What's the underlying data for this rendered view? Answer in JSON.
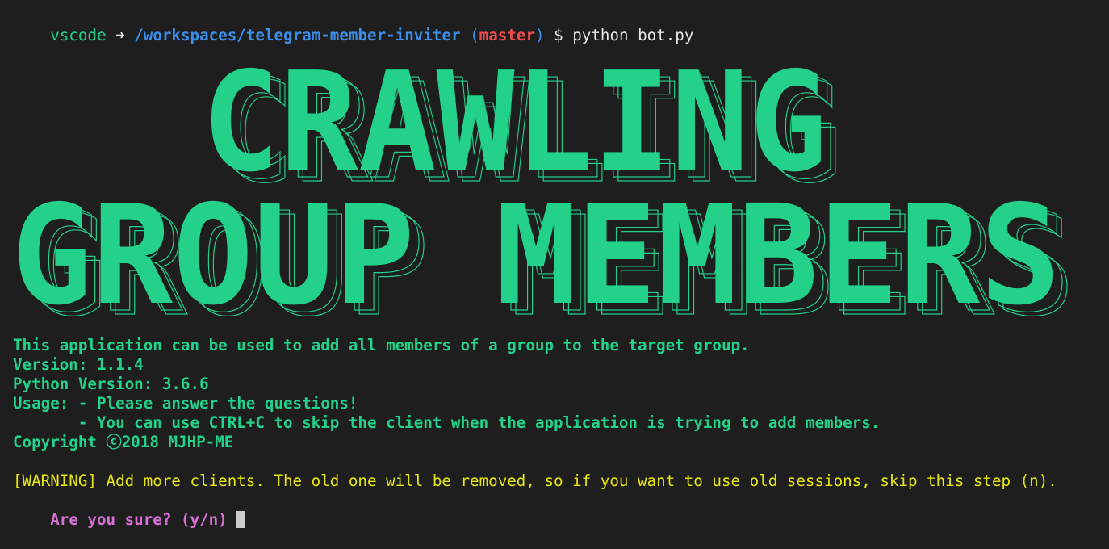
{
  "prompt": {
    "user": "vscode",
    "arrow": "➜",
    "path": "/workspaces/telegram-member-inviter",
    "paren_open": "(",
    "branch": "master",
    "paren_close": ")",
    "dollar": "$",
    "command": "python bot.py"
  },
  "banner": {
    "line1": "CRAWLING",
    "line2": "GROUP MEMBERS",
    "color": "#23d18b"
  },
  "info": {
    "description": "This application can be used to add all members of a group to the target group.",
    "version": "Version: 1.1.4",
    "python_version": "Python Version: 3.6.6",
    "usage_1": "Usage: - Please answer the questions!",
    "usage_2": "       - You can use CTRL+C to skip the client when the application is trying to add members.",
    "copyright": "Copyright ⓒ2018 MJHP-ME"
  },
  "warning": {
    "text": "[WARNING] Add more clients. The old one will be removed, so if you want to use old sessions, skip this step (n)."
  },
  "question": {
    "text": "Are you sure? (y/n) "
  },
  "colors": {
    "background": "#1e1e1e",
    "green": "#23d18b",
    "blue": "#3b8eea",
    "red": "#f14c4c",
    "yellow": "#e5e510",
    "magenta": "#d670d6"
  }
}
